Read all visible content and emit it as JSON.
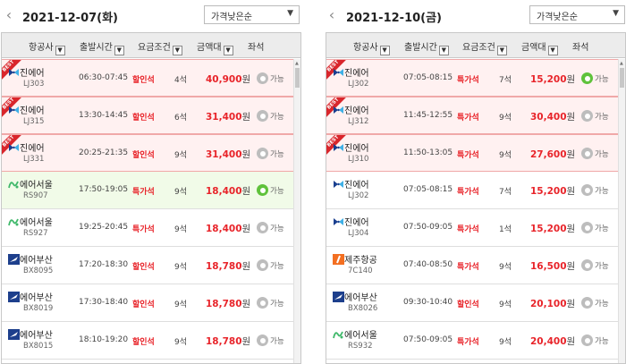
{
  "columns": [
    "항공사",
    "출발시간",
    "요금조건",
    "금액대",
    "좌석"
  ],
  "colors": {
    "best": "#d9262c",
    "price": "#e8242a",
    "radio_on": "#5fc23b",
    "radio_off": "#bdbdbd"
  },
  "left": {
    "date": "2021-12-07(화)",
    "sort_label": "가격낮은순",
    "flights": [
      {
        "airline": "진에어",
        "logo": "jinair-logo",
        "flight_no": "LJ303",
        "time": "06:30-07:45",
        "fare": "할인석",
        "seats": "4석",
        "price": "40,900",
        "won": "원",
        "status": "가능",
        "best": true,
        "best_label": "BEST",
        "selected": false
      },
      {
        "airline": "진에어",
        "logo": "jinair-logo",
        "flight_no": "LJ315",
        "time": "13:30-14:45",
        "fare": "할인석",
        "seats": "6석",
        "price": "31,400",
        "won": "원",
        "status": "가능",
        "best": true,
        "best_label": "BEST",
        "selected": false
      },
      {
        "airline": "진에어",
        "logo": "jinair-logo",
        "flight_no": "LJ331",
        "time": "20:25-21:35",
        "fare": "할인석",
        "seats": "9석",
        "price": "31,400",
        "won": "원",
        "status": "가능",
        "best": true,
        "best_label": "BEST",
        "selected": false
      },
      {
        "airline": "에어서울",
        "logo": "airseoul-logo",
        "flight_no": "RS907",
        "time": "17:50-19:05",
        "fare": "특가석",
        "seats": "9석",
        "price": "18,400",
        "won": "원",
        "status": "가능",
        "best": false,
        "selected": true
      },
      {
        "airline": "에어서울",
        "logo": "airseoul-logo",
        "flight_no": "RS927",
        "time": "19:25-20:45",
        "fare": "특가석",
        "seats": "9석",
        "price": "18,400",
        "won": "원",
        "status": "가능",
        "best": false,
        "selected": false
      },
      {
        "airline": "에어부산",
        "logo": "airbusan-logo",
        "flight_no": "BX8095",
        "time": "17:20-18:30",
        "fare": "할인석",
        "seats": "9석",
        "price": "18,780",
        "won": "원",
        "status": "가능",
        "best": false,
        "selected": false
      },
      {
        "airline": "에어부산",
        "logo": "airbusan-logo",
        "flight_no": "BX8019",
        "time": "17:30-18:40",
        "fare": "할인석",
        "seats": "9석",
        "price": "18,780",
        "won": "원",
        "status": "가능",
        "best": false,
        "selected": false
      },
      {
        "airline": "에어부산",
        "logo": "airbusan-logo",
        "flight_no": "BX8015",
        "time": "18:10-19:20",
        "fare": "할인석",
        "seats": "9석",
        "price": "18,780",
        "won": "원",
        "status": "가능",
        "best": false,
        "selected": false
      }
    ]
  },
  "right": {
    "date": "2021-12-10(금)",
    "sort_label": "가격낮은순",
    "flights": [
      {
        "airline": "진에어",
        "logo": "jinair-logo",
        "flight_no": "LJ302",
        "time": "07:05-08:15",
        "fare": "특가석",
        "seats": "7석",
        "price": "15,200",
        "won": "원",
        "status": "가능",
        "best": true,
        "best_label": "BEST",
        "selected": true
      },
      {
        "airline": "진에어",
        "logo": "jinair-logo",
        "flight_no": "LJ312",
        "time": "11:45-12:55",
        "fare": "특가석",
        "seats": "9석",
        "price": "30,400",
        "won": "원",
        "status": "가능",
        "best": true,
        "best_label": "BEST",
        "selected": false
      },
      {
        "airline": "진에어",
        "logo": "jinair-logo",
        "flight_no": "LJ310",
        "time": "11:50-13:05",
        "fare": "특가석",
        "seats": "9석",
        "price": "27,600",
        "won": "원",
        "status": "가능",
        "best": true,
        "best_label": "BEST",
        "selected": false
      },
      {
        "airline": "진에어",
        "logo": "jinair-logo",
        "flight_no": "LJ302",
        "time": "07:05-08:15",
        "fare": "특가석",
        "seats": "7석",
        "price": "15,200",
        "won": "원",
        "status": "가능",
        "best": false,
        "selected": false
      },
      {
        "airline": "진에어",
        "logo": "jinair-logo",
        "flight_no": "LJ304",
        "time": "07:50-09:05",
        "fare": "특가석",
        "seats": "1석",
        "price": "15,200",
        "won": "원",
        "status": "가능",
        "best": false,
        "selected": false
      },
      {
        "airline": "제주항공",
        "logo": "jejuair-logo",
        "flight_no": "7C140",
        "time": "07:40-08:50",
        "fare": "특가석",
        "seats": "9석",
        "price": "16,500",
        "won": "원",
        "status": "가능",
        "best": false,
        "selected": false
      },
      {
        "airline": "에어부산",
        "logo": "airbusan-logo",
        "flight_no": "BX8026",
        "time": "09:30-10:40",
        "fare": "할인석",
        "seats": "9석",
        "price": "20,100",
        "won": "원",
        "status": "가능",
        "best": false,
        "selected": false
      },
      {
        "airline": "에어서울",
        "logo": "airseoul-logo",
        "flight_no": "RS932",
        "time": "07:50-09:05",
        "fare": "특가석",
        "seats": "9석",
        "price": "20,400",
        "won": "원",
        "status": "가능",
        "best": false,
        "selected": false
      }
    ]
  }
}
